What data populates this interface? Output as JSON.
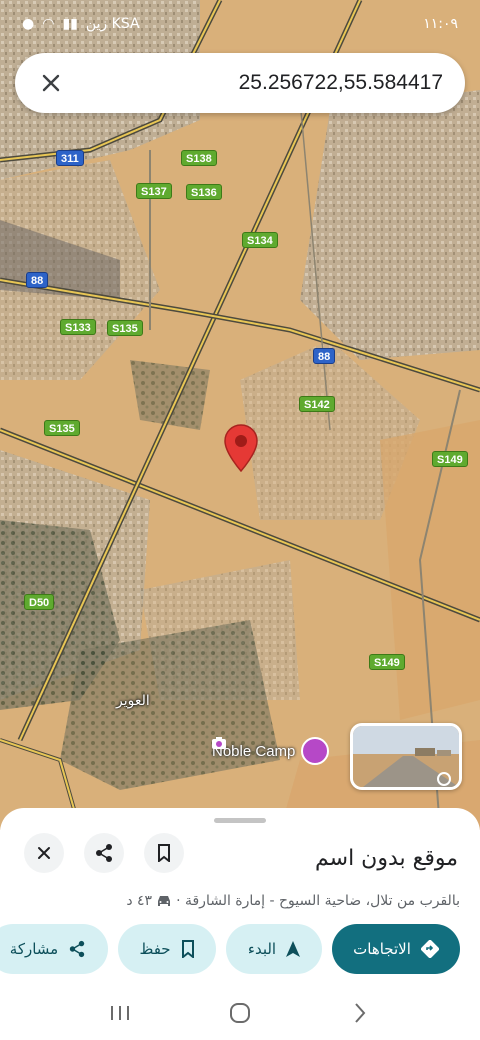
{
  "status_bar": {
    "time": "١١:٠٩",
    "carrier": "زين KSA"
  },
  "search": {
    "value": "25.256722,55.584417",
    "close_icon": "close-icon"
  },
  "map": {
    "route_badges": [
      "S138",
      "S137",
      "S136",
      "S134",
      "S133",
      "S135",
      "S135",
      "S142",
      "S149",
      "S149",
      "311",
      "88",
      "88",
      "D50"
    ],
    "labels": {
      "place_ar": "العوير",
      "poi_name": "Noble Camp"
    },
    "colors": {
      "desert": "#d9b07a",
      "urban": "#bfb7a8",
      "road": "#e8c655",
      "pin": "#e53935",
      "route_green": "#5faa2f",
      "route_blue": "#2d63c8"
    }
  },
  "sheet": {
    "title": "موقع بدون اسم",
    "subtitle_place": "بالقرب من تلال، ضاحية السيوح - إمارة الشارقة ·",
    "drive_time": "٤٣ د",
    "buttons": {
      "directions": "الاتجاهات",
      "start": "البدء",
      "save": "حفظ",
      "share": "مشاركة"
    },
    "accent": "#126f7f"
  }
}
